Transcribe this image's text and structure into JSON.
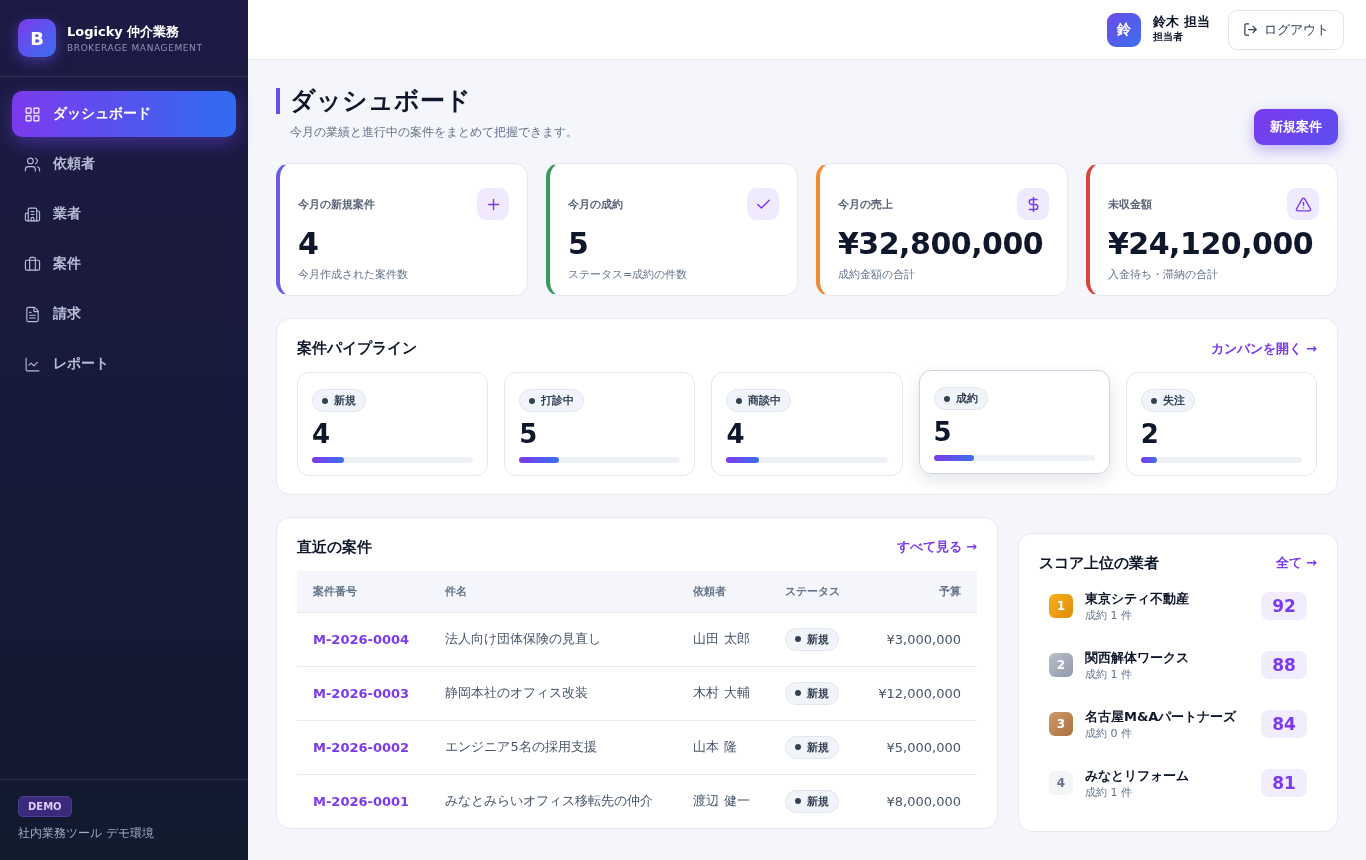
{
  "brand": {
    "logo": "B",
    "name": "Logicky 仲介業務",
    "subtitle": "BROKERAGE MANAGEMENT"
  },
  "nav": [
    {
      "label": "ダッシュボード",
      "selected": true
    },
    {
      "label": "依頼者",
      "selected": false
    },
    {
      "label": "業者",
      "selected": false
    },
    {
      "label": "案件",
      "selected": false
    },
    {
      "label": "請求",
      "selected": false
    },
    {
      "label": "レポート",
      "selected": false
    }
  ],
  "sidebar_footer": {
    "badge": "DEMO",
    "note": "社内業務ツール デモ環境"
  },
  "user": {
    "avatar": "鈴",
    "name": "鈴木 担当",
    "role": "担当者",
    "logout": "ログアウト"
  },
  "page": {
    "title": "ダッシュボード",
    "subtitle": "今月の業績と進行中の案件をまとめて把握できます。",
    "new_button": "新規案件"
  },
  "stats": [
    {
      "label": "今月の新規案件",
      "value": "4",
      "note": "今月作成された案件数",
      "color": "#6d5ce8"
    },
    {
      "label": "今月の成約",
      "value": "5",
      "note": "ステータス=成約の件数",
      "color": "#3a9a5b"
    },
    {
      "label": "今月の売上",
      "value": "¥32,800,000",
      "note": "成約金額の合計",
      "color": "#f08a33"
    },
    {
      "label": "未収金額",
      "value": "¥24,120,000",
      "note": "入金待ち・滞納の合計",
      "color": "#d9453d"
    }
  ],
  "pipeline": {
    "title": "案件パイプライン",
    "link": "カンバンを開く →",
    "stages": [
      {
        "label": "新規",
        "count": "4",
        "level": 0.2,
        "selected": false
      },
      {
        "label": "打診中",
        "count": "5",
        "level": 0.25,
        "selected": false
      },
      {
        "label": "商談中",
        "count": "4",
        "level": 0.2,
        "selected": false
      },
      {
        "label": "成約",
        "count": "5",
        "level": 0.25,
        "selected": true
      },
      {
        "label": "失注",
        "count": "2",
        "level": 0.1,
        "selected": false
      }
    ]
  },
  "recent": {
    "title": "直近の案件",
    "link": "すべて見る →",
    "columns": [
      "案件番号",
      "件名",
      "依頼者",
      "ステータス",
      "予算"
    ],
    "rows": [
      {
        "id": "M-2026-0004",
        "name": "法人向け団体保険の見直し",
        "client": "山田 太郎",
        "status": "新規",
        "budget": "¥3,000,000"
      },
      {
        "id": "M-2026-0003",
        "name": "静岡本社のオフィス改装",
        "client": "木村 大輔",
        "status": "新規",
        "budget": "¥12,000,000"
      },
      {
        "id": "M-2026-0002",
        "name": "エンジニア5名の採用支援",
        "client": "山本 隆",
        "status": "新規",
        "budget": "¥5,000,000"
      },
      {
        "id": "M-2026-0001",
        "name": "みなとみらいオフィス移転先の仲介",
        "client": "渡辺 健一",
        "status": "新規",
        "budget": "¥8,000,000"
      }
    ]
  },
  "vendors": {
    "title": "スコア上位の業者",
    "link": "全て →",
    "items": [
      {
        "rank": "1",
        "kind": "gold",
        "name": "東京シティ不動産",
        "deals": "成約 1 件",
        "score": "92"
      },
      {
        "rank": "2",
        "kind": "silver",
        "name": "関西解体ワークス",
        "deals": "成約 1 件",
        "score": "88"
      },
      {
        "rank": "3",
        "kind": "bronze",
        "name": "名古屋M&Aパートナーズ",
        "deals": "成約 0 件",
        "score": "84"
      },
      {
        "rank": "4",
        "kind": "plain",
        "name": "みなとリフォーム",
        "deals": "成約 1 件",
        "score": "81"
      }
    ]
  }
}
